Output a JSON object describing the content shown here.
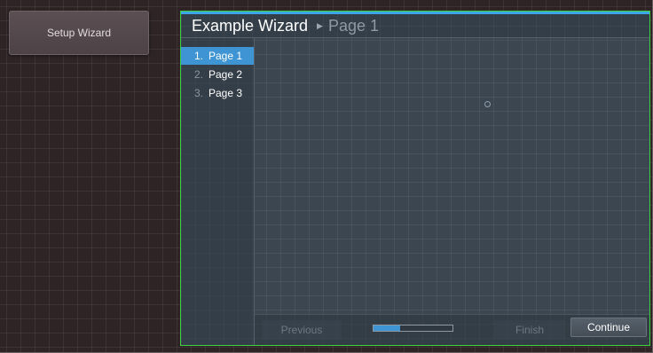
{
  "launcher": {
    "label": "Setup Wizard"
  },
  "wizard": {
    "title": "Example Wizard",
    "current_page": "Page 1",
    "steps": [
      {
        "number": "1.",
        "label": "Page 1",
        "active": true
      },
      {
        "number": "2.",
        "label": "Page 2",
        "active": false
      },
      {
        "number": "3.",
        "label": "Page 3",
        "active": false
      }
    ],
    "footer": {
      "previous_label": "Previous",
      "finish_label": "Finish",
      "continue_label": "Continue",
      "progress_fraction": 0.333
    }
  },
  "icons": {
    "breadcrumb_separator": "chevron-right-icon"
  },
  "colors": {
    "accent": "#3f95d3",
    "wizard_border": "#3fd23f",
    "background": "#2e2426"
  }
}
